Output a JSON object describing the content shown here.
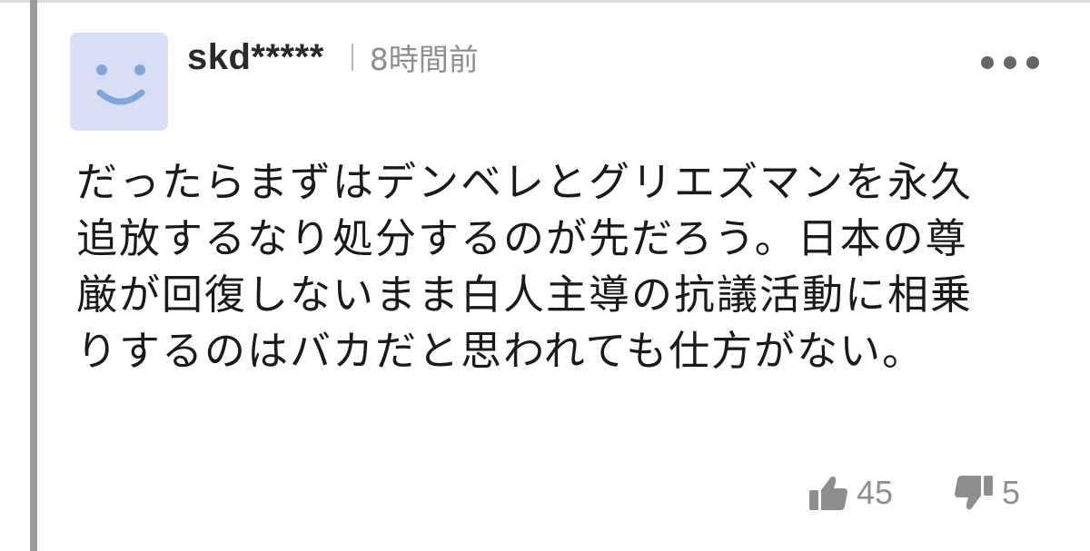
{
  "comment": {
    "author": "skd*****",
    "timestamp": "8時間前",
    "avatar_icon": "smiley-face-icon",
    "avatar_color": "#d9def5",
    "more_icon": "more-dots-icon",
    "body_lines": [
      "だったらまずはデンベレとグリエズマンを永久",
      "追放するなり処分するのが先だろう。日本の尊",
      "厳が回復しないまま白人主導の抗議活動に相乗",
      "りするのはバカだと思われても仕方がない。"
    ],
    "reactions": {
      "like": {
        "icon": "thumbs-up-icon",
        "count": "45"
      },
      "dislike": {
        "icon": "thumbs-down-icon",
        "count": "5"
      }
    }
  },
  "colors": {
    "text": "#1a1a1a",
    "muted": "#8e8e8e",
    "thread_line": "#9b9b9b",
    "avatar_face": "#7ea6d8"
  }
}
